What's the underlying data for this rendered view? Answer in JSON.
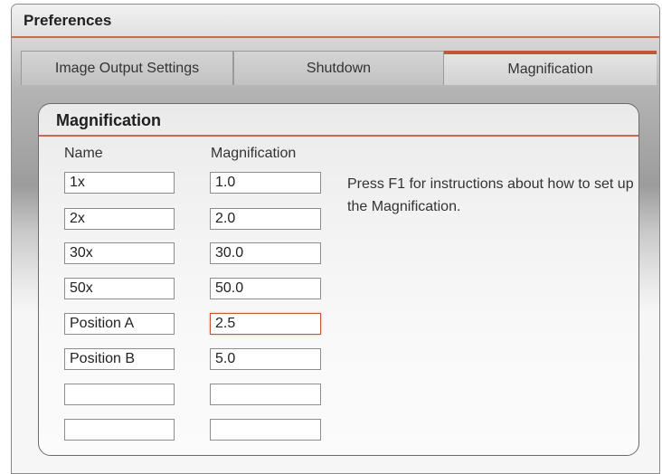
{
  "window": {
    "title": "Preferences"
  },
  "tabs": [
    {
      "label": "Image Output Settings",
      "active": false
    },
    {
      "label": "Shutdown",
      "active": false
    },
    {
      "label": "Magnification",
      "active": true
    }
  ],
  "magnification": {
    "group_title": "Magnification",
    "name_header": "Name",
    "magnification_header": "Magnification",
    "rows": [
      {
        "name": "1x",
        "magnification": "1.0"
      },
      {
        "name": "2x",
        "magnification": "2.0"
      },
      {
        "name": "30x",
        "magnification": "30.0"
      },
      {
        "name": "50x",
        "magnification": "50.0"
      },
      {
        "name": "Position A",
        "magnification": "2.5"
      },
      {
        "name": "Position B",
        "magnification": "5.0"
      },
      {
        "name": "",
        "magnification": ""
      },
      {
        "name": "",
        "magnification": ""
      }
    ],
    "focused_field": "row 5 magnification",
    "help_text": "Press F1 for instructions about how to set up the Magnification."
  },
  "colors": {
    "accent": "#c2553a",
    "title_underline": "#c76b55"
  }
}
